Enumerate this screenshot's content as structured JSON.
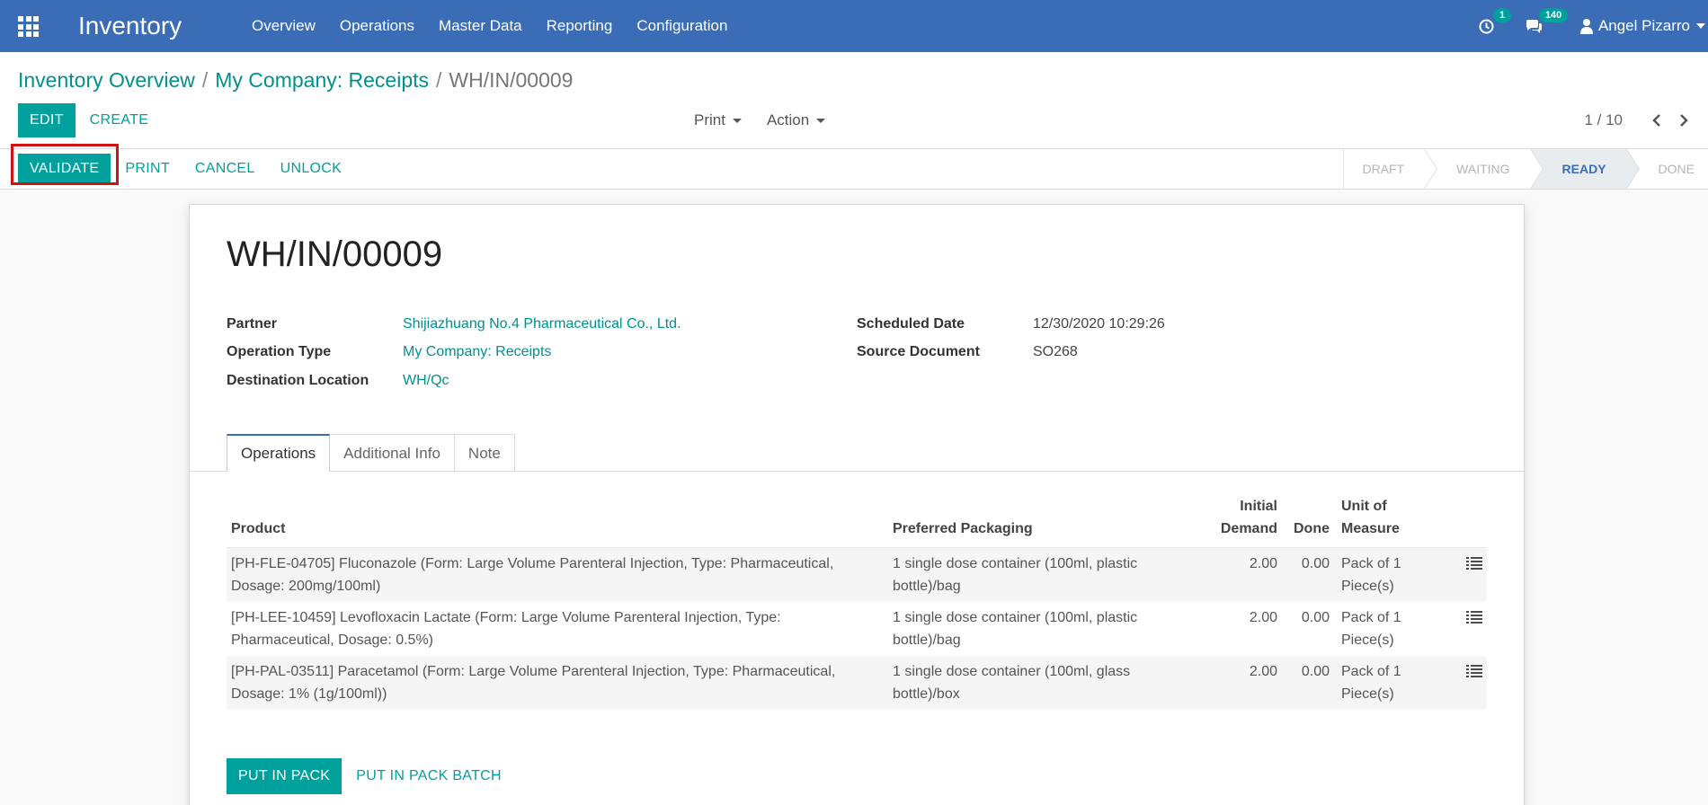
{
  "navbar": {
    "app_title": "Inventory",
    "menu": [
      "Overview",
      "Operations",
      "Master Data",
      "Reporting",
      "Configuration"
    ],
    "activity_count": "1",
    "message_count": "140",
    "user_name": "Angel Pizarro",
    "bg_color": "#3a6db5"
  },
  "breadcrumb": {
    "items": [
      "Inventory Overview",
      "My Company: Receipts"
    ],
    "current": "WH/IN/00009"
  },
  "control_panel": {
    "edit_label": "EDIT",
    "create_label": "CREATE",
    "print_label": "Print",
    "action_label": "Action",
    "pager": "1 / 10"
  },
  "statusbar": {
    "buttons": [
      "VALIDATE",
      "PRINT",
      "CANCEL",
      "UNLOCK"
    ],
    "stages": [
      "DRAFT",
      "WAITING",
      "READY",
      "DONE"
    ],
    "active_stage": "READY"
  },
  "record": {
    "title": "WH/IN/00009",
    "fields_left": [
      {
        "label": "Partner",
        "value": "Shijiazhuang No.4 Pharmaceutical Co., Ltd."
      },
      {
        "label": "Operation Type",
        "value": "My Company: Receipts"
      },
      {
        "label": "Destination Location",
        "value": "WH/Qc"
      }
    ],
    "fields_right": [
      {
        "label": "Scheduled Date",
        "value": "12/30/2020 10:29:26"
      },
      {
        "label": "Source Document",
        "value": "SO268"
      }
    ]
  },
  "tabs": [
    "Operations",
    "Additional Info",
    "Note"
  ],
  "operations": {
    "headers": {
      "product": "Product",
      "packaging": "Preferred Packaging",
      "initial_demand_1": "Initial",
      "initial_demand_2": "Demand",
      "done": "Done",
      "uom_1": "Unit of",
      "uom_2": "Measure"
    },
    "rows": [
      {
        "product_1": "[PH-FLE-04705] Fluconazole (Form: Large Volume Parenteral Injection, Type: Pharmaceutical,",
        "product_2": "Dosage: 200mg/100ml)",
        "packaging_1": "1 single dose container (100ml, plastic",
        "packaging_2": "bottle)/bag",
        "demand": "2.00",
        "done": "0.00",
        "uom_1": "Pack of 1",
        "uom_2": "Piece(s)"
      },
      {
        "product_1": "[PH-LEE-10459] Levofloxacin Lactate (Form: Large Volume Parenteral Injection, Type:",
        "product_2": "Pharmaceutical, Dosage: 0.5%)",
        "packaging_1": "1 single dose container (100ml, plastic",
        "packaging_2": "bottle)/bag",
        "demand": "2.00",
        "done": "0.00",
        "uom_1": "Pack of 1",
        "uom_2": "Piece(s)"
      },
      {
        "product_1": "[PH-PAL-03511] Paracetamol (Form: Large Volume Parenteral Injection, Type: Pharmaceutical,",
        "product_2": "Dosage: 1% (1g/100ml))",
        "packaging_1": "1 single dose container (100ml, glass",
        "packaging_2": "bottle)/box",
        "demand": "2.00",
        "done": "0.00",
        "uom_1": "Pack of 1",
        "uom_2": "Piece(s)"
      }
    ]
  },
  "bottom_buttons": {
    "put_in_pack": "PUT IN PACK",
    "put_in_pack_batch": "PUT IN PACK BATCH"
  }
}
